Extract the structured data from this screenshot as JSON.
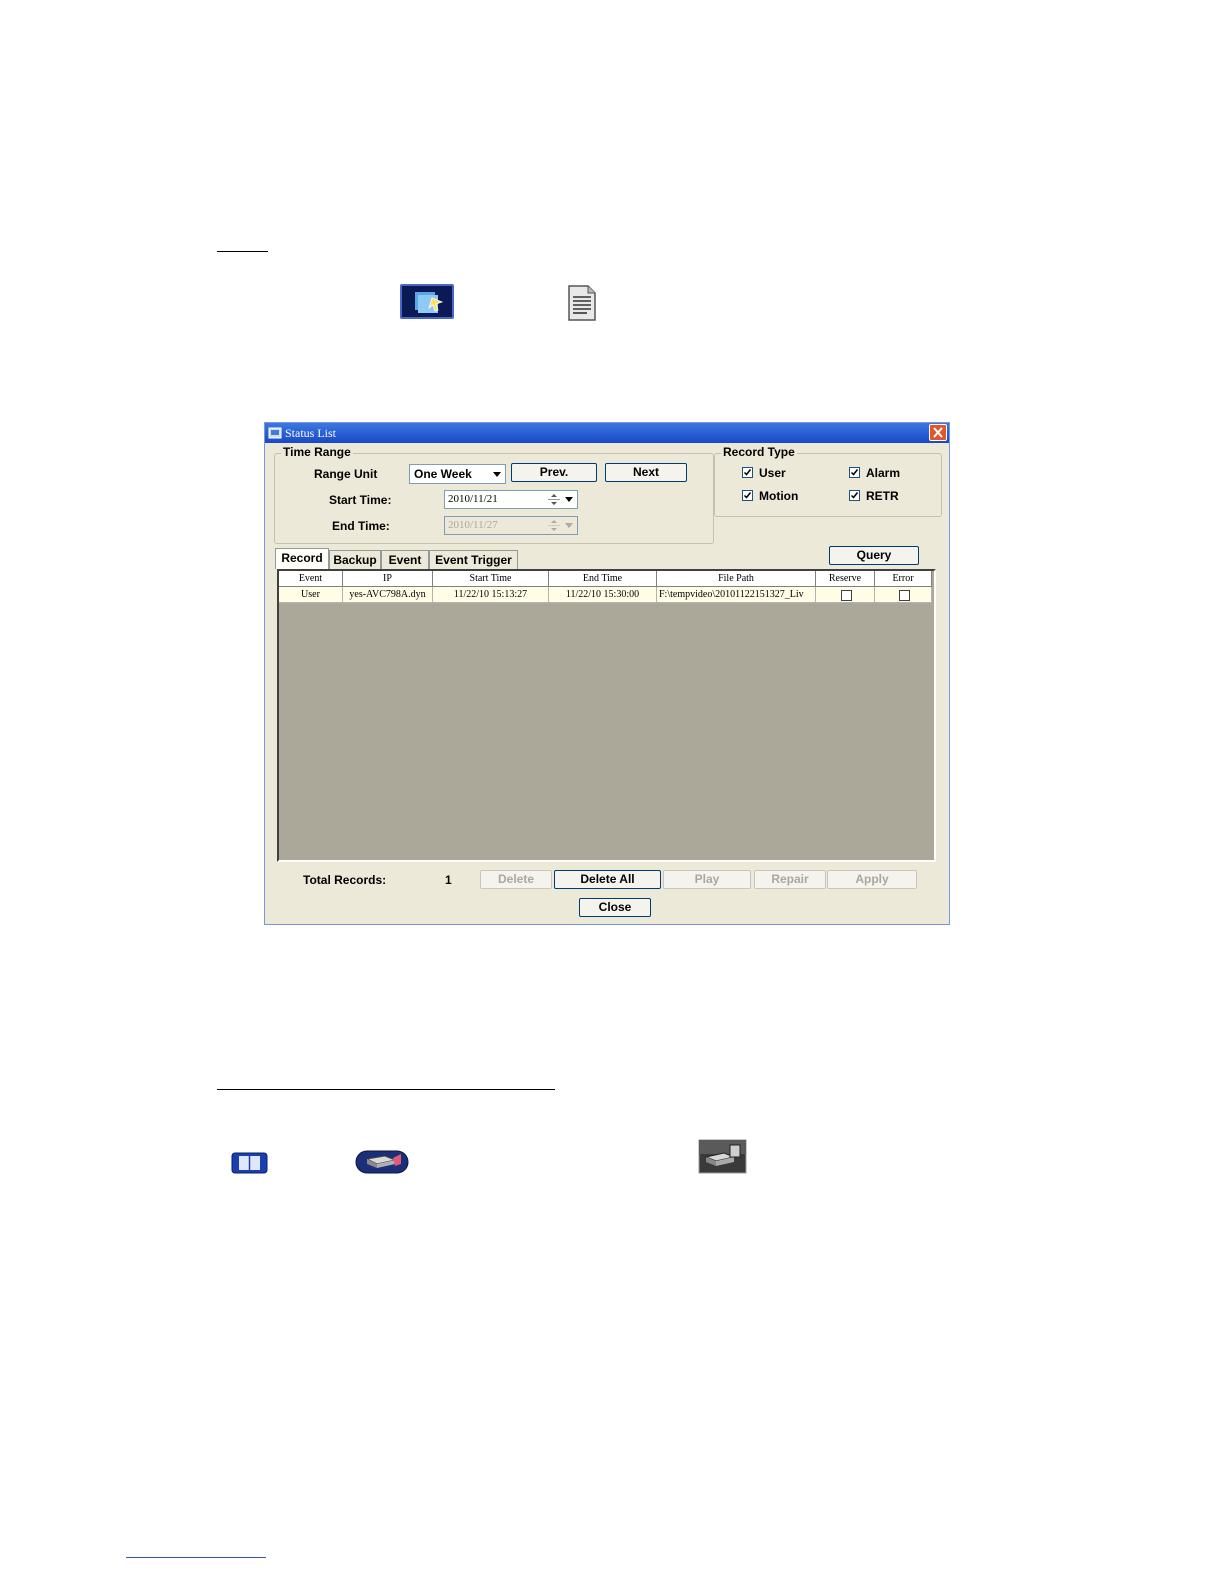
{
  "window": {
    "title": "Status List",
    "time_range": {
      "legend": "Time Range",
      "range_unit_label": "Range Unit",
      "range_unit_value": "One Week",
      "prev_label": "Prev.",
      "next_label": "Next",
      "start_time_label": "Start Time:",
      "start_time_value": "2010/11/21",
      "end_time_label": "End Time:",
      "end_time_value": "2010/11/27"
    },
    "record_type": {
      "legend": "Record Type",
      "options": [
        {
          "label": "User",
          "checked": true
        },
        {
          "label": "Alarm",
          "checked": true
        },
        {
          "label": "Motion",
          "checked": true
        },
        {
          "label": "RETR",
          "checked": true
        }
      ]
    },
    "tabs": [
      "Record",
      "Backup",
      "Event",
      "Event Trigger"
    ],
    "query_label": "Query",
    "table": {
      "columns": [
        "Event",
        "IP",
        "Start Time",
        "End Time",
        "File Path",
        "Reserve",
        "Error"
      ],
      "rows": [
        [
          "User",
          "yes-AVC798A.dyn",
          "11/22/10 15:13:27",
          "11/22/10 15:30:00",
          "F:\\tempvideo\\20101122151327_Liv",
          "",
          ""
        ]
      ]
    },
    "footer": {
      "total_records_label": "Total Records:",
      "total_records_value": "1",
      "delete_label": "Delete",
      "delete_all_label": "Delete All",
      "play_label": "Play",
      "repair_label": "Repair",
      "apply_label": "Apply",
      "close_label": "Close"
    }
  },
  "colors": {
    "titlebar": "#1848c8",
    "window_bg": "#ece9d8",
    "grid_bg": "#aca899",
    "row_bg": "#fffde6"
  }
}
